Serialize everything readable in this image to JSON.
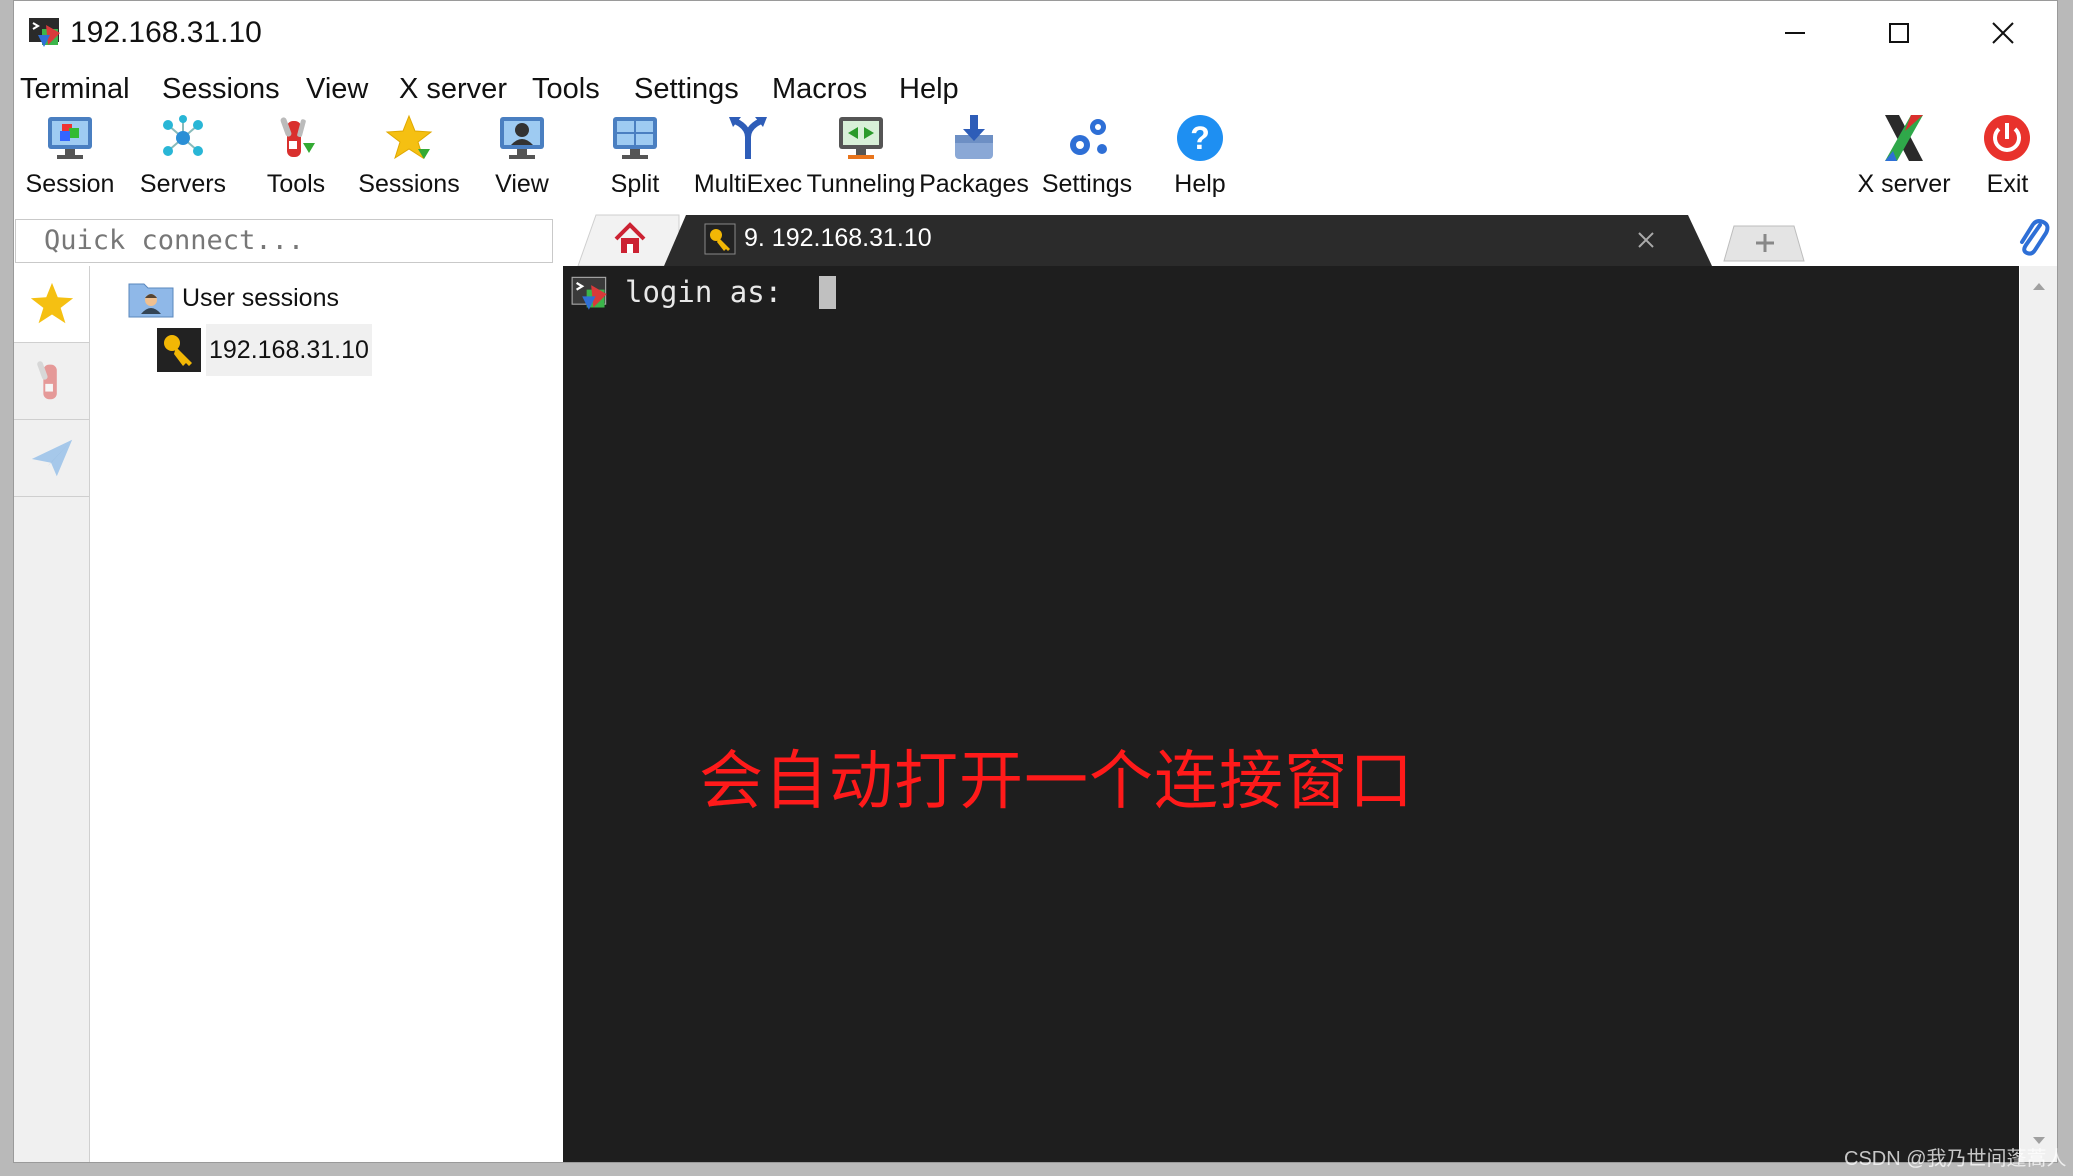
{
  "window": {
    "title": "192.168.31.10"
  },
  "menu": [
    "Terminal",
    "Sessions",
    "View",
    "X server",
    "Tools",
    "Settings",
    "Macros",
    "Help"
  ],
  "toolbar": {
    "session": "Session",
    "servers": "Servers",
    "tools": "Tools",
    "sessions": "Sessions",
    "view": "View",
    "split": "Split",
    "multiexec": "MultiExec",
    "tunneling": "Tunneling",
    "packages": "Packages",
    "settings": "Settings",
    "help": "Help",
    "xserver": "X server",
    "exit": "Exit"
  },
  "quick_connect": {
    "placeholder": "Quick connect..."
  },
  "tabs": {
    "active_label": "9. 192.168.31.10"
  },
  "tree": {
    "folder": "User sessions",
    "item": "192.168.31.10"
  },
  "terminal": {
    "prompt": "login as: "
  },
  "annotation": "会自动打开一个连接窗口",
  "watermark": "CSDN @我乃世间蓬蒿人",
  "colors": {
    "terminal_bg": "#1e1e1e",
    "annotation": "#ff1a1a",
    "active_tab": "#2b2b2b"
  }
}
